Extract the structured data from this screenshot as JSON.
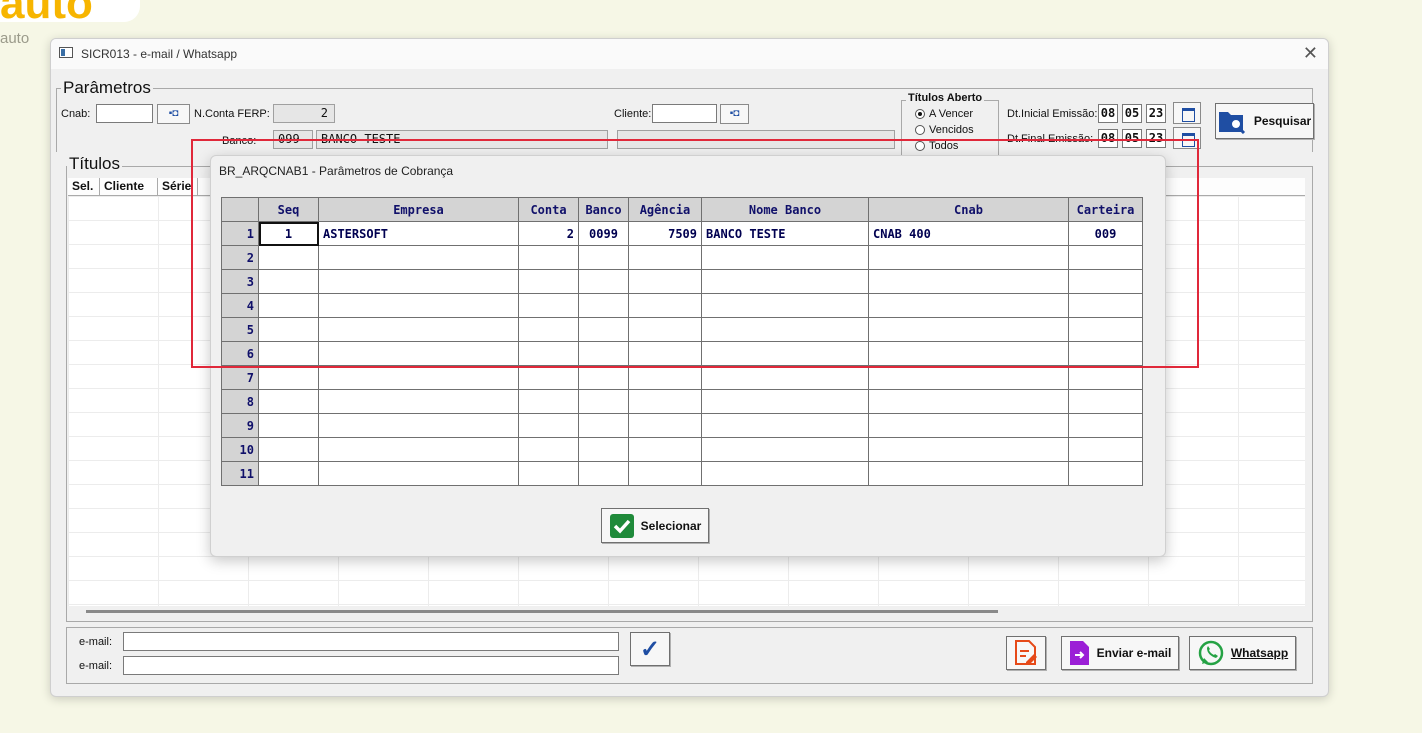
{
  "background_app": {
    "logo_text": "auto"
  },
  "window": {
    "title": "SICR013 - e-mail / Whatsapp",
    "close_glyph": "✕"
  },
  "params": {
    "group_title": "Parâmetros",
    "cnab_label": "Cnab:",
    "cnab_value": "",
    "nconta_label": "N.Conta FERP:",
    "nconta_value": "2",
    "banco_label": "Banco:",
    "banco_code": "099",
    "banco_name": "BANCO TESTE",
    "cliente_label": "Cliente:",
    "cliente_value": "",
    "lookup_label": ".",
    "titulos_aberto": {
      "title": "Títulos Aberto",
      "options": [
        "A Vencer",
        "Vencidos",
        "Todos"
      ],
      "selected": "A Vencer"
    },
    "dt_inicial_label": "Dt.Inicial Emissão:",
    "dt_inicial": [
      "08",
      "05",
      "23"
    ],
    "dt_final_label": "Dt.Final Emissão:",
    "dt_final": [
      "08",
      "05",
      "23"
    ],
    "pesquisar_label": "Pesquisar"
  },
  "titulos": {
    "group_title": "Títulos",
    "columns": [
      "Sel.",
      "Cliente",
      "Série"
    ]
  },
  "email": {
    "label1": "e-mail:",
    "value1": "",
    "label2": "e-mail:",
    "value2": "",
    "check_glyph": "✓"
  },
  "actions": {
    "enviar_email": "Enviar e-mail",
    "whatsapp": "Whatsapp"
  },
  "modal": {
    "title": "BR_ARQCNAB1 - Parâmetros de Cobrança",
    "columns": [
      "Seq",
      "Empresa",
      "Conta",
      "Banco",
      "Agência",
      "Nome Banco",
      "Cnab",
      "Carteira"
    ],
    "row_numbers": [
      "1",
      "2",
      "3",
      "4",
      "5",
      "6",
      "7",
      "8",
      "9",
      "10",
      "11"
    ],
    "rows": [
      [
        "1",
        "ASTERSOFT",
        "2",
        "0099",
        "7509",
        "BANCO TESTE",
        "CNAB 400",
        "009"
      ],
      [
        "",
        "",
        "",
        "",
        "",
        "",
        "",
        ""
      ],
      [
        "",
        "",
        "",
        "",
        "",
        "",
        "",
        ""
      ],
      [
        "",
        "",
        "",
        "",
        "",
        "",
        "",
        ""
      ],
      [
        "",
        "",
        "",
        "",
        "",
        "",
        "",
        ""
      ],
      [
        "",
        "",
        "",
        "",
        "",
        "",
        "",
        ""
      ],
      [
        "",
        "",
        "",
        "",
        "",
        "",
        "",
        ""
      ],
      [
        "",
        "",
        "",
        "",
        "",
        "",
        "",
        ""
      ],
      [
        "",
        "",
        "",
        "",
        "",
        "",
        "",
        ""
      ],
      [
        "",
        "",
        "",
        "",
        "",
        "",
        "",
        ""
      ],
      [
        "",
        "",
        "",
        "",
        "",
        "",
        "",
        ""
      ]
    ],
    "selecionar_label": "Selecionar"
  },
  "colors": {
    "highlight": "#e0283a",
    "grid_header_text": "#10106a",
    "accent_blue": "#1f4ea3",
    "whatsapp_green": "#25a244",
    "purple": "#9b1fd6",
    "check_green": "#1f8a3a"
  }
}
